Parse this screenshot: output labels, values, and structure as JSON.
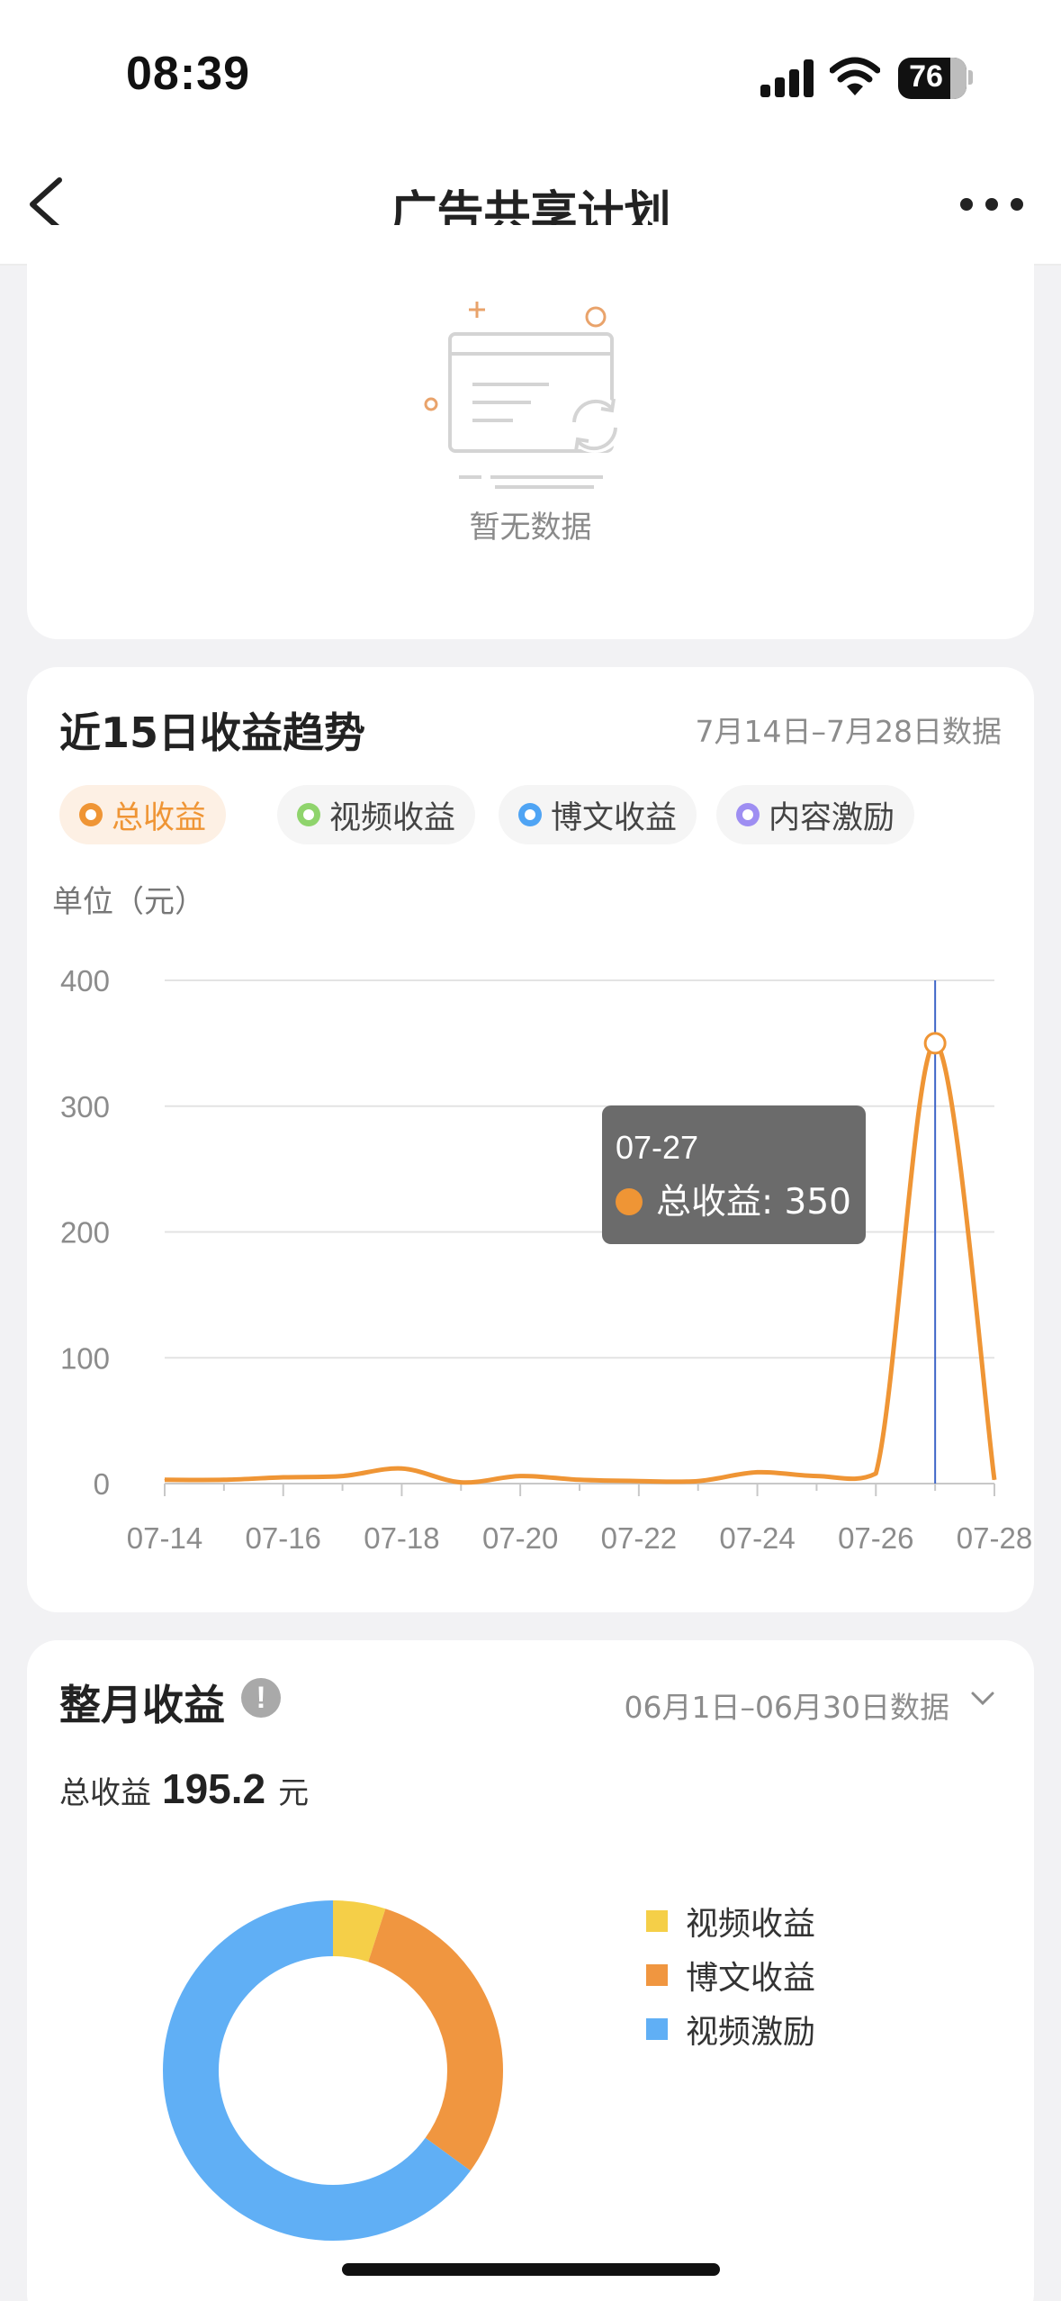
{
  "status_bar": {
    "time": "08:39",
    "battery": "76"
  },
  "nav": {
    "title": "广告共享计划"
  },
  "empty_state": {
    "text": "暂无数据"
  },
  "trend": {
    "title": "近15日收益趋势",
    "range": "7月14日–7月28日数据",
    "unit": "单位（元）",
    "filters": [
      {
        "label": "总收益",
        "color": "#ef9535",
        "active": true
      },
      {
        "label": "视频收益",
        "color": "#8fd46c",
        "active": false
      },
      {
        "label": "博文收益",
        "color": "#4fa4f4",
        "active": false
      },
      {
        "label": "内容激励",
        "color": "#9e8ef2",
        "active": false
      }
    ],
    "tooltip": {
      "date": "07-27",
      "label": "总收益: 350"
    }
  },
  "chart_data": [
    {
      "type": "line",
      "title": "近15日收益趋势",
      "ylabel": "单位（元）",
      "x": [
        "07-14",
        "07-15",
        "07-16",
        "07-17",
        "07-18",
        "07-19",
        "07-20",
        "07-21",
        "07-22",
        "07-23",
        "07-24",
        "07-25",
        "07-26",
        "07-27",
        "07-28"
      ],
      "x_tick_labels": [
        "07-14",
        "07-16",
        "07-18",
        "07-20",
        "07-22",
        "07-24",
        "07-26",
        "07-28"
      ],
      "y_ticks": [
        0,
        100,
        200,
        300,
        400
      ],
      "ylim": [
        0,
        400
      ],
      "series": [
        {
          "name": "总收益",
          "color": "#ef9535",
          "values": [
            3,
            3,
            5,
            6,
            12,
            1,
            6,
            3,
            2,
            2,
            9,
            6,
            8,
            350,
            3
          ]
        }
      ],
      "highlight": {
        "x": "07-27",
        "value": 350
      },
      "grid": true
    },
    {
      "type": "pie",
      "subtype": "donut",
      "labels": [
        "视频收益",
        "博文收益",
        "视频激励"
      ],
      "values": [
        5,
        30,
        65
      ],
      "colors": [
        "#f5cf48",
        "#f09640",
        "#60aff5"
      ]
    }
  ],
  "monthly": {
    "title": "整月收益",
    "info_icon": "!",
    "range": "06月1日–06月30日数据",
    "total_label": "总收益",
    "total_value": "195.2",
    "total_unit": "元"
  }
}
